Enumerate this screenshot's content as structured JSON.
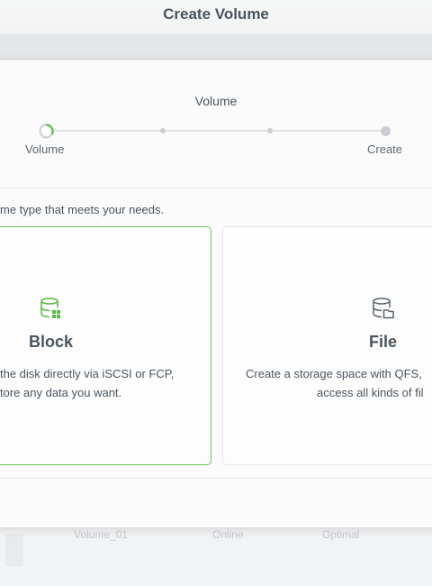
{
  "window": {
    "title": "Create Volume"
  },
  "wizard": {
    "current_step_title": "Volume",
    "steps": [
      {
        "label": "Volume"
      },
      {
        "label": ""
      },
      {
        "label": ""
      },
      {
        "label": "Create"
      }
    ]
  },
  "instruction": "me type that meets your needs.",
  "options": [
    {
      "title": "Block",
      "icon": "block-storage-icon",
      "selected": true,
      "description_line1": "the disk directly via iSCSI or FCP,",
      "description_line2": "tore any data you want."
    },
    {
      "title": "File",
      "icon": "file-storage-icon",
      "selected": false,
      "description_line1": "Create a storage space with QFS,",
      "description_line2": "access all kinds of fil"
    }
  ],
  "background_table_row": {
    "name": "Volume_01",
    "status": "Online",
    "state": "Optimal"
  },
  "colors": {
    "accent": "#6ac259",
    "text": "#4a5560"
  }
}
